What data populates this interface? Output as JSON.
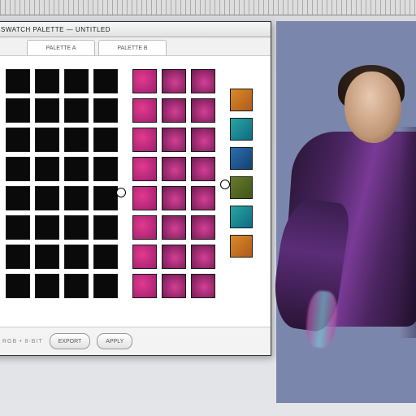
{
  "window": {
    "title": "SWATCH PALETTE — UNTITLED"
  },
  "tabs": [
    {
      "label": "PALETTE A"
    },
    {
      "label": "PALETTE B"
    }
  ],
  "footer": {
    "button1": "EXPORT",
    "button2": "APPLY",
    "status": "RGB • 8-BIT"
  },
  "palettes": {
    "a": {
      "rows": 8,
      "cols": 4,
      "swatch": "black"
    },
    "b": {
      "rows": 8,
      "cols": 3,
      "swatch": "magenta"
    },
    "side": [
      "orange",
      "teal",
      "blue",
      "olive",
      "teal",
      "orange"
    ]
  }
}
